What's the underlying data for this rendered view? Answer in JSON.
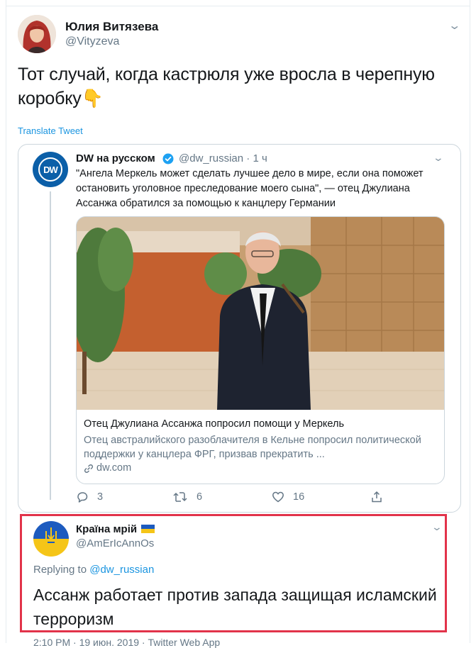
{
  "main_tweet": {
    "author_name": "Юлия Витязева",
    "handle": "@Vityzeva",
    "text": "Тот случай, когда кастрюля уже вросла в черепную коробку",
    "emoji": "👇",
    "translate_label": "Translate Tweet"
  },
  "quoted_tweet": {
    "author_name": "DW на русском",
    "avatar_label": "DW",
    "handle": "@dw_russian",
    "time": "· 1 ч",
    "text": "\"Ангела Меркель может сделать лучшее дело в мире, если она поможет остановить уголовное преследование моего сына\", — отец Джулиана Ассанжа обратился за помощью к канцлеру Германии",
    "card": {
      "title": "Отец Джулиана Ассанжа попросил помощи у Меркель",
      "description": "Отец австралийского разоблачителя в Кельне попросил политической поддержки у канцлера ФРГ, призвав прекратить ...",
      "domain": "dw.com"
    },
    "actions": {
      "replies": "3",
      "retweets": "6",
      "likes": "16"
    }
  },
  "reply_tweet": {
    "author_name": "Країна мрій",
    "handle": "@AmErIcAnnOs",
    "replying_label": "Replying to",
    "replying_to": "@dw_russian",
    "text": "Ассанж работает против запада защищая исламский терроризм",
    "footer_partial": "2:10 PM · 19 июн. 2019 · Twitter Web App"
  },
  "colors": {
    "link_blue": "#1b95e0",
    "muted_gray": "#657786",
    "highlight_red": "#e2334a",
    "dw_blue": "#0b5fa8"
  }
}
